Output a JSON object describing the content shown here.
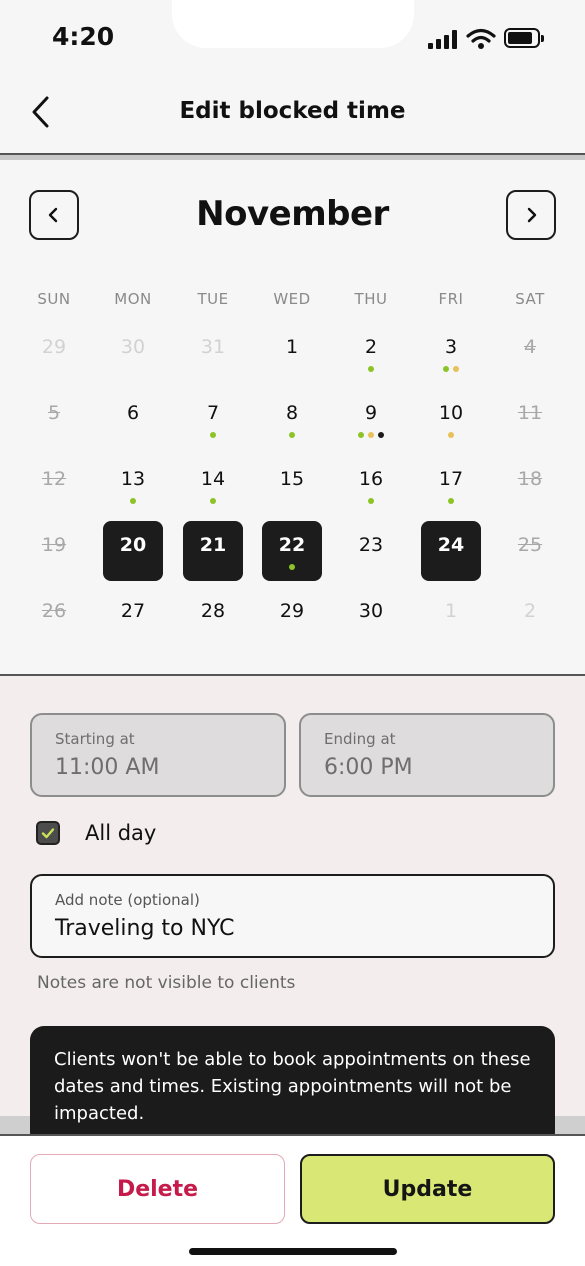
{
  "status_bar": {
    "time": "4:20"
  },
  "header": {
    "title": "Edit blocked time",
    "back_icon": "chevron-left-icon"
  },
  "calendar": {
    "month": "November",
    "weekdays": [
      "SUN",
      "MON",
      "TUE",
      "WED",
      "THU",
      "FRI",
      "SAT"
    ],
    "dot_colors": {
      "green": "#8dc425",
      "gold": "#e7c15a",
      "black": "#1b1b1b"
    },
    "weeks": [
      [
        {
          "label": "29",
          "state": "muted"
        },
        {
          "label": "30",
          "state": "muted"
        },
        {
          "label": "31",
          "state": "muted"
        },
        {
          "label": "1",
          "state": "normal"
        },
        {
          "label": "2",
          "state": "normal",
          "dots": [
            "green"
          ]
        },
        {
          "label": "3",
          "state": "normal",
          "dots": [
            "green",
            "gold"
          ]
        },
        {
          "label": "4",
          "state": "strike"
        }
      ],
      [
        {
          "label": "5",
          "state": "strike"
        },
        {
          "label": "6",
          "state": "normal"
        },
        {
          "label": "7",
          "state": "normal",
          "dots": [
            "green"
          ]
        },
        {
          "label": "8",
          "state": "normal",
          "dots": [
            "green"
          ]
        },
        {
          "label": "9",
          "state": "normal",
          "dots": [
            "green",
            "gold",
            "black"
          ]
        },
        {
          "label": "10",
          "state": "normal",
          "dots": [
            "gold"
          ]
        },
        {
          "label": "11",
          "state": "strike"
        }
      ],
      [
        {
          "label": "12",
          "state": "strike"
        },
        {
          "label": "13",
          "state": "normal",
          "dots": [
            "green"
          ]
        },
        {
          "label": "14",
          "state": "normal",
          "dots": [
            "green"
          ]
        },
        {
          "label": "15",
          "state": "normal"
        },
        {
          "label": "16",
          "state": "normal",
          "dots": [
            "green"
          ]
        },
        {
          "label": "17",
          "state": "normal",
          "dots": [
            "green"
          ]
        },
        {
          "label": "18",
          "state": "strike"
        }
      ],
      [
        {
          "label": "19",
          "state": "strike"
        },
        {
          "label": "20",
          "state": "selected"
        },
        {
          "label": "21",
          "state": "selected"
        },
        {
          "label": "22",
          "state": "selected",
          "dots": [
            "green"
          ]
        },
        {
          "label": "23",
          "state": "normal"
        },
        {
          "label": "24",
          "state": "selected"
        },
        {
          "label": "25",
          "state": "strike"
        }
      ],
      [
        {
          "label": "26",
          "state": "strike"
        },
        {
          "label": "27",
          "state": "normal"
        },
        {
          "label": "28",
          "state": "normal"
        },
        {
          "label": "29",
          "state": "normal"
        },
        {
          "label": "30",
          "state": "normal"
        },
        {
          "label": "1",
          "state": "muted"
        },
        {
          "label": "2",
          "state": "muted"
        }
      ]
    ]
  },
  "form": {
    "start": {
      "label": "Starting at",
      "value": "11:00 AM"
    },
    "end": {
      "label": "Ending at",
      "value": "6:00 PM"
    },
    "all_day": {
      "label": "All day",
      "checked": true
    },
    "note": {
      "label": "Add note (optional)",
      "value": "Traveling to NYC"
    },
    "hint": "Notes are not visible to clients"
  },
  "toast": {
    "text": "Clients won't be able to book appointments on these dates and times. Existing appointments will not be impacted."
  },
  "actions": {
    "delete_label": "Delete",
    "update_label": "Update"
  }
}
